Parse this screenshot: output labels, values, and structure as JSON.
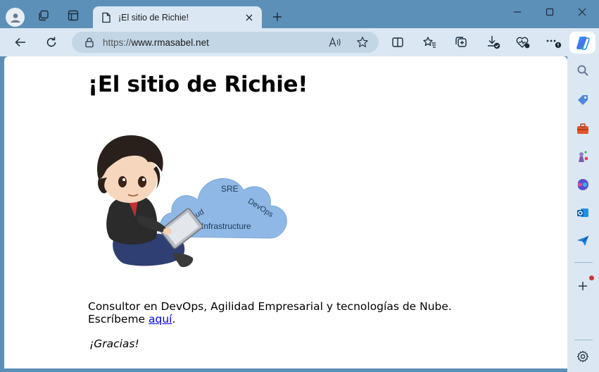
{
  "browser": {
    "tab_title": "¡El sitio de Richie!",
    "url_scheme": "https://",
    "url_host": "www.rmasabel.net"
  },
  "page": {
    "heading": "¡El sitio de Richie!",
    "illustration": {
      "labels": [
        "SRE",
        "Cloud",
        "DevOps",
        "Infrastructure"
      ]
    },
    "line1": "Consultor en DevOps, Agilidad Empresarial y tecnologías de Nube.",
    "line2_prefix": "Escríbeme ",
    "line2_link": "aquí",
    "line2_suffix": ".",
    "thanks": "¡Gracias!"
  },
  "colors": {
    "titlebar": "#5d90b8",
    "toolbar": "#dbe8f3",
    "link": "#0000ee",
    "cloud": "#8fb8e6"
  },
  "icons": {
    "toolbar": [
      "back-icon",
      "refresh-icon",
      "lock-icon",
      "read-aloud-icon",
      "favorite-star-icon",
      "split-screen-icon",
      "favorites-icon",
      "collections-icon",
      "downloads-icon",
      "browser-essentials-icon",
      "more-icon"
    ],
    "sidebar": [
      "copilot-icon",
      "search-icon",
      "shopping-icon",
      "tools-icon",
      "games-icon",
      "microsoft-365-icon",
      "outlook-icon",
      "send-icon",
      "add-icon",
      "settings-icon"
    ]
  }
}
